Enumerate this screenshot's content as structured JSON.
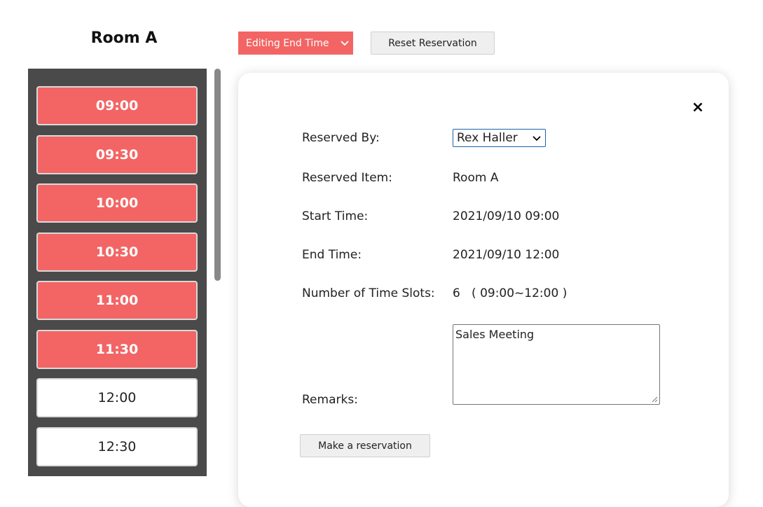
{
  "header": {
    "room_title": "Room A",
    "mode_select": {
      "selected": "Editing End Time",
      "icon": "chevron-down-icon"
    },
    "reset_label": "Reset Reservation"
  },
  "slots": [
    {
      "time": "09:00",
      "state": "reserved"
    },
    {
      "time": "09:30",
      "state": "reserved"
    },
    {
      "time": "10:00",
      "state": "reserved"
    },
    {
      "time": "10:30",
      "state": "reserved"
    },
    {
      "time": "11:00",
      "state": "reserved"
    },
    {
      "time": "11:30",
      "state": "reserved"
    },
    {
      "time": "12:00",
      "state": "free"
    },
    {
      "time": "12:30",
      "state": "free"
    }
  ],
  "detail": {
    "close_icon": "close-icon",
    "reserved_by_label": "Reserved By:",
    "reserved_by_value": "Rex Haller",
    "reserved_item_label": "Reserved Item:",
    "reserved_item_value": "Room A",
    "start_time_label": "Start Time:",
    "start_time_value": "2021/09/10 09:00",
    "end_time_label": "End Time:",
    "end_time_value": "2021/09/10 12:00",
    "slots_label": "Number of Time Slots:",
    "slots_value": "6   ( 09:00~12:00 )",
    "remarks_label": "Remarks:",
    "remarks_value": "Sales Meeting",
    "submit_label": "Make a reservation"
  },
  "colors": {
    "reserved": "#f26564",
    "panel": "#4a4a4a",
    "free": "#ffffff"
  }
}
